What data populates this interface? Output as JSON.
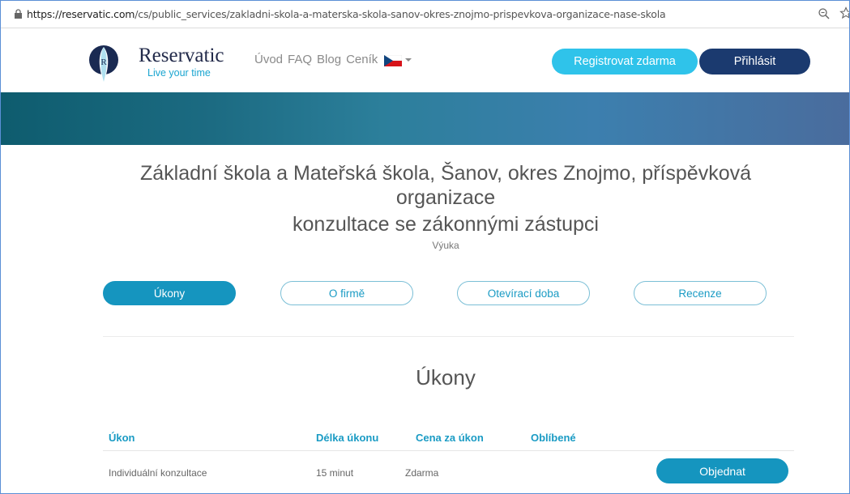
{
  "browser": {
    "url_host": "https://reservatic.com",
    "url_path": "/cs/public_services/zakladni-skola-a-materska-skola-sanov-okres-znojmo-prispevkova-organizace-nase-skola"
  },
  "header": {
    "brand_name": "Reservatic",
    "tagline": "Live your time",
    "nav": [
      "Úvod",
      "FAQ",
      "Blog",
      "Ceník"
    ],
    "register_label": "Registrovat zdarma",
    "login_label": "Přihlásit"
  },
  "service": {
    "title": "Základní škola a Mateřská škola, Šanov, okres Znojmo, příspěvková organizace",
    "subtitle": "konzultace se zákonnými zástupci",
    "category": "Výuka"
  },
  "tabs": [
    {
      "label": "Úkony",
      "active": true
    },
    {
      "label": "O firmě",
      "active": false
    },
    {
      "label": "Otevírací doba",
      "active": false
    },
    {
      "label": "Recenze",
      "active": false
    }
  ],
  "section": {
    "title": "Úkony",
    "columns": [
      "Úkon",
      "Délka úkonu",
      "Cena za úkon",
      "Oblíbené"
    ],
    "rows": [
      {
        "name": "Individuální konzultace",
        "duration": "15 minut",
        "price": "Zdarma",
        "action_label": "Objednat"
      }
    ]
  },
  "colors": {
    "accent": "#1595bf",
    "register": "#2fc3ea",
    "login": "#1b3a6f",
    "tagline": "#1aa5d0"
  }
}
